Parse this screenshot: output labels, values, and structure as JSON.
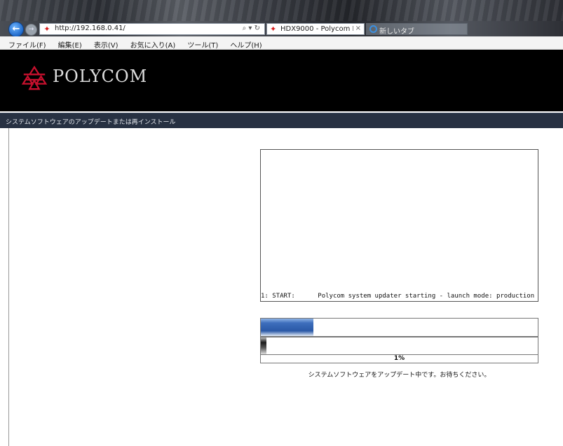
{
  "browser": {
    "address_url": "http://192.168.0.41/",
    "address_tools": "⌕ ▾ ↻",
    "tabs": [
      {
        "label": "HDX9000 - Polycom HD...",
        "close": "×",
        "active": true
      },
      {
        "label": "新しいタブ",
        "active": false
      }
    ],
    "menu": [
      "ファイル(F)",
      "編集(E)",
      "表示(V)",
      "お気に入り(A)",
      "ツール(T)",
      "ヘルプ(H)"
    ]
  },
  "brand": {
    "logo_text": "POLYCOM",
    "logo_color": "#c8102e"
  },
  "page": {
    "title": "システムソフトウェアのアップデートまたは再インストール"
  },
  "updater": {
    "log_line": "1: START:      Polycom system updater starting - launch mode: production",
    "overall_progress": 0.19,
    "step_progress": 0.02,
    "percent_label": "1%",
    "status_message": "システムソフトウェアをアップデート中です。お待ちください。"
  }
}
